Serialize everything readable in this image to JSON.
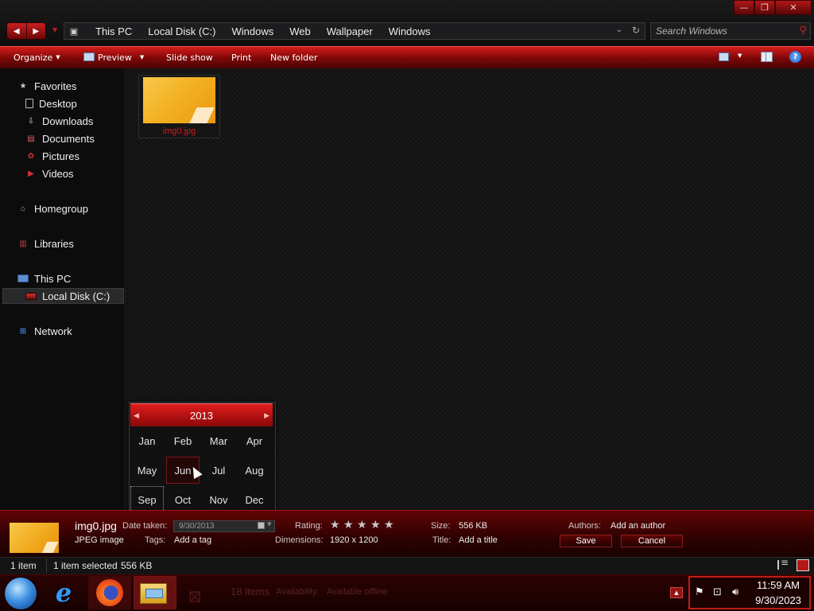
{
  "window": {
    "controls": {
      "minimize": "—",
      "maximize": "❐",
      "close": "✕"
    }
  },
  "address": {
    "breadcrumbs": [
      "This PC",
      "Local Disk (C:)",
      "Windows",
      "Web",
      "Wallpaper",
      "Windows"
    ]
  },
  "search": {
    "placeholder": "Search Windows"
  },
  "commandbar": {
    "organize": "Organize",
    "preview": "Preview",
    "slideshow": "Slide show",
    "print": "Print",
    "new_folder": "New folder"
  },
  "nav": {
    "favorites": "Favorites",
    "desktop": "Desktop",
    "downloads": "Downloads",
    "documents": "Documents",
    "pictures": "Pictures",
    "videos": "Videos",
    "homegroup": "Homegroup",
    "libraries": "Libraries",
    "this_pc": "This PC",
    "local_disk": "Local Disk (C:)",
    "network": "Network"
  },
  "files": [
    {
      "name": "img0.jpg"
    }
  ],
  "picker": {
    "year": "2013",
    "months": [
      "Jan",
      "Feb",
      "Mar",
      "Apr",
      "May",
      "Jun",
      "Jul",
      "Aug",
      "Sep",
      "Oct",
      "Nov",
      "Dec"
    ],
    "hovered": "Jun",
    "current": "Sep"
  },
  "details": {
    "name": "img0.jpg",
    "type": "JPEG image",
    "date_taken_label": "Date taken:",
    "date_taken_value": "9/30/2013",
    "tags_label": "Tags:",
    "tags_value": "Add a tag",
    "rating_label": "Rating:",
    "rating_stars": 5,
    "dimensions_label": "Dimensions:",
    "dimensions_value": "1920 x 1200",
    "size_label": "Size:",
    "size_value": "556 KB",
    "title_label": "Title:",
    "title_value": "Add a title",
    "authors_label": "Authors:",
    "authors_value": "Add an author",
    "save": "Save",
    "cancel": "Cancel"
  },
  "status": {
    "item_count": "1 item",
    "selected": "1 item selected",
    "selected_size": "556 KB"
  },
  "taskbar": {
    "ghost_items": "18 items",
    "ghost_availability": "Availability:",
    "ghost_offline": "Available offline",
    "clock_time": "11:59 AM",
    "clock_date": "9/30/2023"
  },
  "colors": {
    "accent": "#c01c1c",
    "background": "#0b0b0c"
  }
}
